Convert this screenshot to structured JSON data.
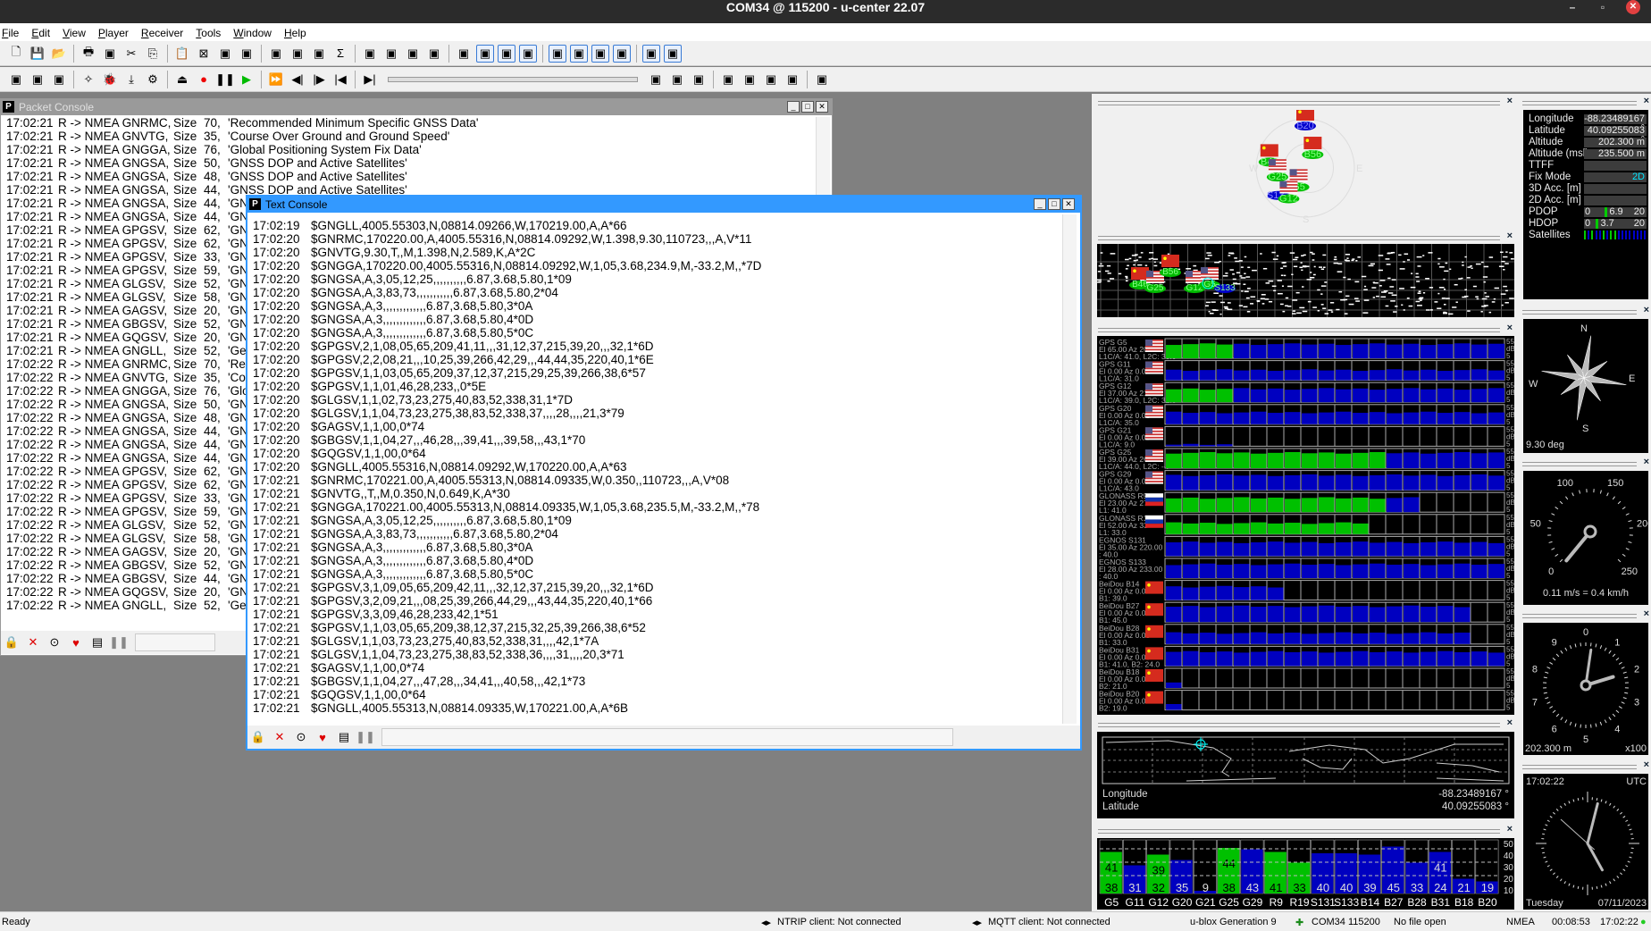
{
  "window": {
    "title": "COM34 @ 115200 - u-center 22.07",
    "minimize": "–",
    "maximize": "▫",
    "close": "✕"
  },
  "menu": [
    "File",
    "Edit",
    "View",
    "Player",
    "Receiver",
    "Tools",
    "Window",
    "Help"
  ],
  "toolbar1": [
    "new-file",
    "save",
    "open",
    "print",
    "print-preview",
    "cut",
    "copy",
    "paste",
    "delete",
    "new-text",
    "new-binary",
    "new-template",
    "pane-left",
    "pane-right",
    "sigma",
    "table-view",
    "chart-view",
    "line-chart",
    "bar-chart",
    "deviation-map",
    "sky-view-toggle",
    "packet-console",
    "signal-chart",
    "data-view",
    "text-console",
    "compass",
    "world-map",
    "clock",
    "satellite-view"
  ],
  "toolbar2": [
    "receiver-connection",
    "baud-rate",
    "autobaud",
    "wizard",
    "debug",
    "download",
    "settings",
    "eject",
    "record",
    "pause",
    "play",
    "fast-forward",
    "step-back",
    "step-forward",
    "rewind",
    "seek-end",
    "hot-start",
    "warm-start",
    "cold-start",
    "gnss-config",
    "gnss-antenna",
    "gear-1",
    "gear-2",
    "gear-3"
  ],
  "packet_console": {
    "title": "Packet Console",
    "lines": [
      [
        "17:02:21",
        "R -> NMEA GNRMC,",
        "Size",
        "70,",
        "'Recommended Minimum Specific GNSS Data'"
      ],
      [
        "17:02:21",
        "R -> NMEA GNVTG,",
        "Size",
        "35,",
        "'Course Over Ground and Ground Speed'"
      ],
      [
        "17:02:21",
        "R -> NMEA GNGGA,",
        "Size",
        "76,",
        "'Global Positioning System Fix Data'"
      ],
      [
        "17:02:21",
        "R -> NMEA GNGSA,",
        "Size",
        "50,",
        "'GNSS DOP and Active Satellites'"
      ],
      [
        "17:02:21",
        "R -> NMEA GNGSA,",
        "Size",
        "48,",
        "'GNSS DOP and Active Satellites'"
      ],
      [
        "17:02:21",
        "R -> NMEA GNGSA,",
        "Size",
        "44,",
        "'GNSS DOP and Active Satellites'"
      ],
      [
        "17:02:21",
        "R -> NMEA GNGSA,",
        "Size",
        "44,",
        "'GN"
      ],
      [
        "17:02:21",
        "R -> NMEA GNGSA,",
        "Size",
        "44,",
        "'GN"
      ],
      [
        "17:02:21",
        "R -> NMEA GPGSV,",
        "Size",
        "62,",
        "'GN"
      ],
      [
        "17:02:21",
        "R -> NMEA GPGSV,",
        "Size",
        "62,",
        "'GN"
      ],
      [
        "17:02:21",
        "R -> NMEA GPGSV,",
        "Size",
        "33,",
        "'GN"
      ],
      [
        "17:02:21",
        "R -> NMEA GPGSV,",
        "Size",
        "59,",
        "'GN"
      ],
      [
        "17:02:21",
        "R -> NMEA GLGSV,",
        "Size",
        "52,",
        "'GN"
      ],
      [
        "17:02:21",
        "R -> NMEA GLGSV,",
        "Size",
        "58,",
        "'GN"
      ],
      [
        "17:02:21",
        "R -> NMEA GAGSV,",
        "Size",
        "20,",
        "'GN"
      ],
      [
        "17:02:21",
        "R -> NMEA GBGSV,",
        "Size",
        "52,",
        "'GN"
      ],
      [
        "17:02:21",
        "R -> NMEA GQGSV,",
        "Size",
        "20,",
        "'GN"
      ],
      [
        "17:02:21",
        "R -> NMEA GNGLL,",
        "Size",
        "52,",
        "'Geo"
      ],
      [
        "17:02:22",
        "R -> NMEA GNRMC,",
        "Size",
        "70,",
        "'Re"
      ],
      [
        "17:02:22",
        "R -> NMEA GNVTG,",
        "Size",
        "35,",
        "'Cou"
      ],
      [
        "17:02:22",
        "R -> NMEA GNGGA,",
        "Size",
        "76,",
        "'Glo"
      ],
      [
        "17:02:22",
        "R -> NMEA GNGSA,",
        "Size",
        "50,",
        "'GN"
      ],
      [
        "17:02:22",
        "R -> NMEA GNGSA,",
        "Size",
        "48,",
        "'GN"
      ],
      [
        "17:02:22",
        "R -> NMEA GNGSA,",
        "Size",
        "44,",
        "'GN"
      ],
      [
        "17:02:22",
        "R -> NMEA GNGSA,",
        "Size",
        "44,",
        "'GN"
      ],
      [
        "17:02:22",
        "R -> NMEA GNGSA,",
        "Size",
        "44,",
        "'GN"
      ],
      [
        "17:02:22",
        "R -> NMEA GPGSV,",
        "Size",
        "62,",
        "'GN"
      ],
      [
        "17:02:22",
        "R -> NMEA GPGSV,",
        "Size",
        "62,",
        "'GN"
      ],
      [
        "17:02:22",
        "R -> NMEA GPGSV,",
        "Size",
        "33,",
        "'GN"
      ],
      [
        "17:02:22",
        "R -> NMEA GPGSV,",
        "Size",
        "59,",
        "'GN"
      ],
      [
        "17:02:22",
        "R -> NMEA GLGSV,",
        "Size",
        "52,",
        "'GN"
      ],
      [
        "17:02:22",
        "R -> NMEA GLGSV,",
        "Size",
        "58,",
        "'GN"
      ],
      [
        "17:02:22",
        "R -> NMEA GAGSV,",
        "Size",
        "20,",
        "'GN"
      ],
      [
        "17:02:22",
        "R -> NMEA GBGSV,",
        "Size",
        "52,",
        "'GN"
      ],
      [
        "17:02:22",
        "R -> NMEA GBGSV,",
        "Size",
        "44,",
        "'GN"
      ],
      [
        "17:02:22",
        "R -> NMEA GQGSV,",
        "Size",
        "20,",
        "'GN"
      ],
      [
        "17:02:22",
        "R -> NMEA GNGLL,",
        "Size",
        "52,",
        "'Geo"
      ]
    ]
  },
  "text_console": {
    "title": "Text Console",
    "lines": [
      [
        "17:02:19",
        "$GNGLL,4005.55303,N,08814.09266,W,170219.00,A,A*66"
      ],
      [
        "17:02:20",
        "$GNRMC,170220.00,A,4005.55316,N,08814.09292,W,1.398,9.30,110723,,,A,V*11"
      ],
      [
        "17:02:20",
        "$GNVTG,9.30,T,,M,1.398,N,2.589,K,A*2C"
      ],
      [
        "17:02:20",
        "$GNGGA,170220.00,4005.55316,N,08814.09292,W,1,05,3.68,234.9,M,-33.2,M,,*7D"
      ],
      [
        "17:02:20",
        "$GNGSA,A,3,05,12,25,,,,,,,,,,6.87,3.68,5.80,1*09"
      ],
      [
        "17:02:20",
        "$GNGSA,A,3,83,73,,,,,,,,,,,6.87,3.68,5.80,2*04"
      ],
      [
        "17:02:20",
        "$GNGSA,A,3,,,,,,,,,,,,,6.87,3.68,5.80,3*0A"
      ],
      [
        "17:02:20",
        "$GNGSA,A,3,,,,,,,,,,,,,6.87,3.68,5.80,4*0D"
      ],
      [
        "17:02:20",
        "$GNGSA,A,3,,,,,,,,,,,,,6.87,3.68,5.80,5*0C"
      ],
      [
        "17:02:20",
        "$GPGSV,2,1,08,05,65,209,41,11,,,31,12,37,215,39,20,,,32,1*6D"
      ],
      [
        "17:02:20",
        "$GPGSV,2,2,08,21,,,10,25,39,266,42,29,,,44,44,35,220,40,1*6E"
      ],
      [
        "17:02:20",
        "$GPGSV,1,1,03,05,65,209,37,12,37,215,29,25,39,266,38,6*57"
      ],
      [
        "17:02:20",
        "$GPGSV,1,1,01,46,28,233,,0*5E"
      ],
      [
        "17:02:20",
        "$GLGSV,1,1,02,73,23,275,40,83,52,338,31,1*7D"
      ],
      [
        "17:02:20",
        "$GLGSV,1,1,04,73,23,275,38,83,52,338,37,,,,28,,,,21,3*79"
      ],
      [
        "17:02:20",
        "$GAGSV,1,1,00,0*74"
      ],
      [
        "17:02:20",
        "$GBGSV,1,1,04,27,,,46,28,,,39,41,,,39,58,,,43,1*70"
      ],
      [
        "17:02:20",
        "$GQGSV,1,1,00,0*64"
      ],
      [
        "17:02:20",
        "$GNGLL,4005.55316,N,08814.09292,W,170220.00,A,A*63"
      ],
      [
        "17:02:21",
        "$GNRMC,170221.00,A,4005.55313,N,08814.09335,W,0.350,,110723,,,A,V*08"
      ],
      [
        "17:02:21",
        "$GNVTG,,T,,M,0.350,N,0.649,K,A*30"
      ],
      [
        "17:02:21",
        "$GNGGA,170221.00,4005.55313,N,08814.09335,W,1,05,3.68,235.5,M,-33.2,M,,*78"
      ],
      [
        "17:02:21",
        "$GNGSA,A,3,05,12,25,,,,,,,,,,6.87,3.68,5.80,1*09"
      ],
      [
        "17:02:21",
        "$GNGSA,A,3,83,73,,,,,,,,,,,6.87,3.68,5.80,2*04"
      ],
      [
        "17:02:21",
        "$GNGSA,A,3,,,,,,,,,,,,,6.87,3.68,5.80,3*0A"
      ],
      [
        "17:02:21",
        "$GNGSA,A,3,,,,,,,,,,,,,6.87,3.68,5.80,4*0D"
      ],
      [
        "17:02:21",
        "$GNGSA,A,3,,,,,,,,,,,,,6.87,3.68,5.80,5*0C"
      ],
      [
        "17:02:21",
        "$GPGSV,3,1,09,05,65,209,42,11,,,32,12,37,215,39,20,,,32,1*6D"
      ],
      [
        "17:02:21",
        "$GPGSV,3,2,09,21,,,08,25,39,266,44,29,,,43,44,35,220,40,1*66"
      ],
      [
        "17:02:21",
        "$GPGSV,3,3,09,46,28,233,42,1*51"
      ],
      [
        "17:02:21",
        "$GPGSV,1,1,03,05,65,209,38,12,37,215,32,25,39,266,38,6*52"
      ],
      [
        "17:02:21",
        "$GLGSV,1,1,03,73,23,275,40,83,52,338,31,,,,42,1*7A"
      ],
      [
        "17:02:21",
        "$GLGSV,1,1,04,73,23,275,38,83,52,338,36,,,,31,,,,20,3*71"
      ],
      [
        "17:02:21",
        "$GAGSV,1,1,00,0*74"
      ],
      [
        "17:02:21",
        "$GBGSV,1,1,04,27,,,47,28,,,34,41,,,40,58,,,42,1*73"
      ],
      [
        "17:02:21",
        "$GQGSV,1,1,00,0*64"
      ],
      [
        "17:02:21",
        "$GNGLL,4005.55313,N,08814.09335,W,170221.00,A,A*6B"
      ]
    ]
  },
  "console_toolbar": [
    "lock",
    "clear",
    "pc-filter",
    "marker",
    "save-log",
    "pause"
  ],
  "sky_view": {
    "labels": {
      "n": "",
      "e": "E",
      "s": "S",
      "w": "W"
    },
    "sats": [
      {
        "id": "B20",
        "az": 0,
        "el": 0,
        "flag": "cn",
        "color": "#0000cc"
      },
      {
        "id": "B56",
        "az": 20,
        "el": 50,
        "flag": "cn",
        "color": "#00c000"
      },
      {
        "id": "B46",
        "az": 290,
        "el": 20,
        "flag": "cn",
        "color": "#00c000"
      },
      {
        "id": "G25",
        "az": 266,
        "el": 39,
        "flag": "us",
        "color": "#00c000"
      },
      {
        "id": "G5",
        "az": 209,
        "el": 65,
        "flag": "us",
        "color": "#00c000"
      },
      {
        "id": "S133",
        "az": 233,
        "el": 28,
        "flag": "",
        "color": "#0000cc"
      },
      {
        "id": "G12",
        "az": 215,
        "el": 37,
        "flag": "us",
        "color": "#00c000"
      }
    ]
  },
  "world_sats": [
    "B46",
    "G25",
    "B56",
    "G12",
    "G5",
    "S133"
  ],
  "signals": {
    "scale": {
      "top": "55",
      "unit": "dB",
      "bottom": "5"
    },
    "sats": [
      {
        "name": "GPS G5",
        "pos": "El 65.00 Az 20",
        "sig": "L1C/A: 41.0, L2C: 38.0",
        "flag": "us",
        "cno": 41,
        "bars": 20,
        "green": 4
      },
      {
        "name": "GPS G11",
        "pos": "El 0.00 Az 0.00",
        "sig": "L1C/A: 31.0",
        "flag": "us",
        "cno": 31,
        "bars": 20,
        "green": 0
      },
      {
        "name": "GPS G12",
        "pos": "El 37.00 Az 21",
        "sig": "L1C/A: 39.0, L2C: 32.0",
        "flag": "us",
        "cno": 39,
        "bars": 20,
        "green": 4
      },
      {
        "name": "GPS G20",
        "pos": "El 0.00 Az 0.00",
        "sig": "L1C/A: 35.0",
        "flag": "us",
        "cno": 35,
        "bars": 20,
        "green": 0
      },
      {
        "name": "GPS G21",
        "pos": "El 0.00 Az 0.00",
        "sig": "L1C/A: 9.0",
        "flag": "us",
        "cno": 9,
        "bars": 4,
        "green": 0
      },
      {
        "name": "GPS G25",
        "pos": "El 39.00 Az 26",
        "sig": "L1C/A: 44.0, L2C: --.-",
        "flag": "us",
        "cno": 44,
        "bars": 20,
        "green": 13
      },
      {
        "name": "GPS G29",
        "pos": "El 0.00 Az 0.00",
        "sig": "L1C/A: 43.0",
        "flag": "us",
        "cno": 43,
        "bars": 20,
        "green": 0
      },
      {
        "name": "GLONASS R9",
        "pos": "El 23.00 Az 27",
        "sig": "L1: 41.0",
        "flag": "ru",
        "cno": 41,
        "bars": 15,
        "green": 13
      },
      {
        "name": "GLONASS R19",
        "pos": "El 52.00 Az 33",
        "sig": "L1: 33.0",
        "flag": "ru",
        "cno": 33,
        "bars": 12,
        "green": 12
      },
      {
        "name": "EGNOS S131",
        "pos": "El 35.00 Az 220.00",
        "sig": ": 40.0",
        "flag": "",
        "cno": 40,
        "bars": 20,
        "green": 0
      },
      {
        "name": "EGNOS S133",
        "pos": "El 28.00 Az 233.00",
        "sig": ": 40.0",
        "flag": "",
        "cno": 40,
        "bars": 20,
        "green": 0
      },
      {
        "name": "BeiDou B14",
        "pos": "El 0.00 Az 0.00",
        "sig": "B1: 39.0",
        "flag": "cn",
        "cno": 39,
        "bars": 7,
        "green": 0
      },
      {
        "name": "BeiDou B27",
        "pos": "El 0.00 Az 0.00",
        "sig": "B1: 45.0",
        "flag": "cn",
        "cno": 45,
        "bars": 18,
        "green": 0
      },
      {
        "name": "BeiDou B28",
        "pos": "El 0.00 Az 0.00",
        "sig": "B1: 33.0",
        "flag": "cn",
        "cno": 33,
        "bars": 18,
        "green": 0
      },
      {
        "name": "BeiDou B31",
        "pos": "El 0.00 Az 0.00",
        "sig": "B1: 41.0, B2: 24.0",
        "flag": "cn",
        "cno": 41,
        "bars": 20,
        "green": 0
      },
      {
        "name": "BeiDou B18",
        "pos": "El 0.00 Az 0.00",
        "sig": "B2: 21.0",
        "flag": "cn",
        "cno": 21,
        "bars": 1,
        "green": 0
      },
      {
        "name": "BeiDou B20",
        "pos": "El 0.00 Az 0.00",
        "sig": "B2: 19.0",
        "flag": "cn",
        "cno": 19,
        "bars": 1,
        "green": 0
      }
    ]
  },
  "map": {
    "lon_label": "Longitude",
    "lon": "-88.23489167 °",
    "lat_label": "Latitude",
    "lat": "40.09255083 °"
  },
  "cno_bars": {
    "ylim": [
      10,
      50
    ],
    "ticks": [
      "50",
      "40",
      "30",
      "20",
      "10"
    ],
    "sats": [
      {
        "id": "G5",
        "v": 41,
        "v2": 38,
        "used": true
      },
      {
        "id": "G11",
        "v": 31,
        "used": false
      },
      {
        "id": "G12",
        "v": 39,
        "v2": 32,
        "used": true
      },
      {
        "id": "G20",
        "v": 35,
        "used": false
      },
      {
        "id": "G21",
        "v": 9,
        "used": false
      },
      {
        "id": "G25",
        "v": 44,
        "v2": 38,
        "used": true
      },
      {
        "id": "G29",
        "v": 43,
        "used": false
      },
      {
        "id": "R9",
        "v": 41,
        "used": true
      },
      {
        "id": "R19",
        "v": 33,
        "used": true
      },
      {
        "id": "S131",
        "v": 40,
        "used": false
      },
      {
        "id": "S133",
        "v": 40,
        "used": false
      },
      {
        "id": "B14",
        "v": 39,
        "used": false
      },
      {
        "id": "B27",
        "v": 45,
        "used": false
      },
      {
        "id": "B28",
        "v": 33,
        "used": false
      },
      {
        "id": "B31",
        "v": 41,
        "v2": 24,
        "used": false
      },
      {
        "id": "B18",
        "v": 21,
        "used": false
      },
      {
        "id": "B20",
        "v": 19,
        "used": false
      }
    ]
  },
  "data_view": {
    "rows": [
      {
        "label": "Longitude",
        "value": "-88.23489167 °"
      },
      {
        "label": "Latitude",
        "value": "40.09255083 °"
      },
      {
        "label": "Altitude",
        "value": "202.300 m"
      },
      {
        "label": "Altitude (msl)",
        "value": "235.500 m"
      },
      {
        "label": "TTFF",
        "value": ""
      },
      {
        "label": "Fix Mode",
        "value": "2D"
      },
      {
        "label": "3D Acc. [m]",
        "value": ""
      },
      {
        "label": "2D Acc. [m]",
        "value": ""
      }
    ],
    "pdop": {
      "label": "PDOP",
      "min": "0",
      "value": "6.9",
      "max": "20"
    },
    "hdop": {
      "label": "HDOP",
      "min": "0",
      "value": "3.7",
      "max": "20"
    },
    "satellites_label": "Satellites",
    "fix_color": "#00e5ff"
  },
  "compass": {
    "heading_deg": 9.3,
    "text": "9.30 deg",
    "n": "N",
    "e": "E",
    "s": "S",
    "w": "W"
  },
  "speedometer": {
    "ticks": [
      "0",
      "50",
      "100",
      "150",
      "200",
      "250"
    ],
    "kmh": 0.4,
    "text": "0.11 m/s = 0.4 km/h"
  },
  "altimeter": {
    "digits": [
      "0",
      "1",
      "2",
      "3",
      "4",
      "5",
      "6",
      "7",
      "8",
      "9"
    ],
    "altitude_m": 202.3,
    "text": "202.300 m",
    "mult": "x100"
  },
  "clock": {
    "time": "17:02:22",
    "tz": "UTC",
    "day": "Tuesday",
    "date": "07/11/2023",
    "h": 17,
    "m": 2,
    "s": 22
  },
  "status": {
    "ready": "Ready",
    "ntrip": "NTRIP client: Not connected",
    "mqtt": "MQTT client: Not connected",
    "gen": "u-blox Generation 9",
    "port": "COM34 115200",
    "file": "No file open",
    "proto": "NMEA",
    "elapsed": "00:08:53",
    "time": "17:02:22"
  }
}
